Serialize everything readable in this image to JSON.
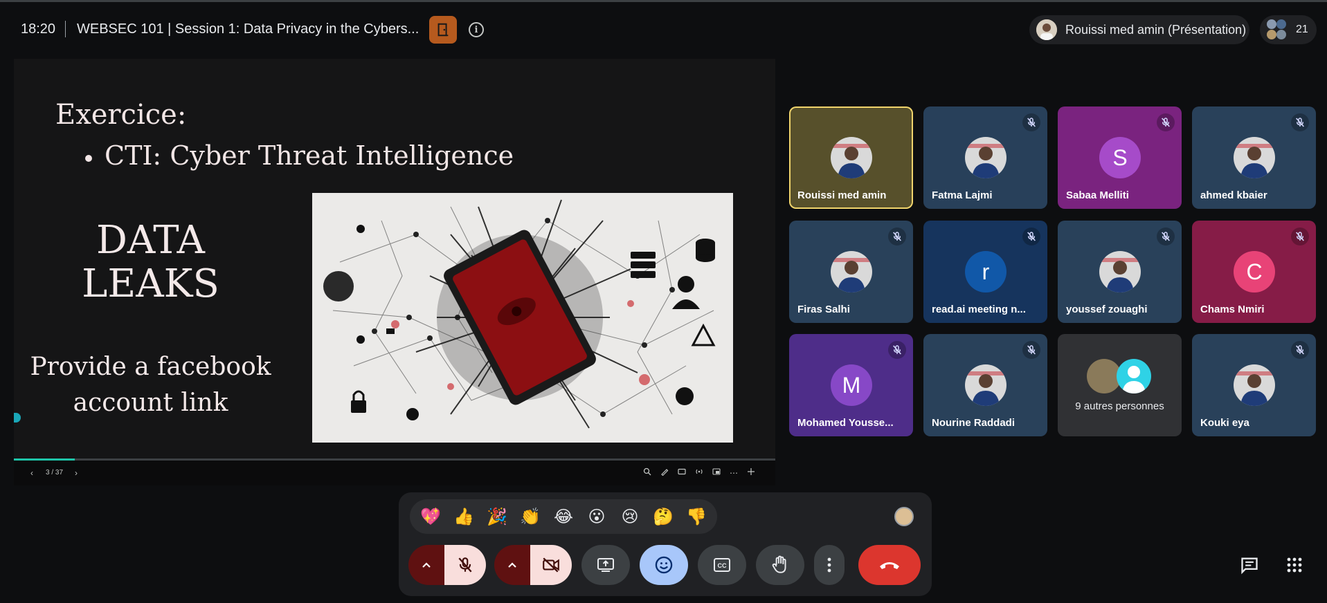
{
  "topbar": {
    "time": "18:20",
    "meeting_title": "WEBSEC 101 | Session 1: Data Privacy in the Cybers...",
    "presenter_chip_label": "Rouissi med amin (Présentation)",
    "participant_count": "21"
  },
  "slide": {
    "heading": "Exercice:",
    "bullet": "CTI: Cyber Threat Intelligence",
    "big_line_1": "DATA",
    "big_line_2": "LEAKS",
    "sub_line_1": "Provide a facebook",
    "sub_line_2": "account link",
    "progress_fraction": 0.08
  },
  "slide_controls": {
    "page_indicator": "3 / 37"
  },
  "tiles": [
    {
      "name": "Rouissi med amin",
      "kind": "photo",
      "active": true,
      "muted": false,
      "bg": "#57502b"
    },
    {
      "name": "Fatma Lajmi",
      "kind": "photo",
      "active": false,
      "muted": true,
      "bg": "#28405a"
    },
    {
      "name": "Sabaa Melliti",
      "kind": "letter",
      "letter": "S",
      "letter_bg": "#a64bc9",
      "active": false,
      "muted": true,
      "bg": "#7a237f"
    },
    {
      "name": "ahmed kbaier",
      "kind": "photo",
      "active": false,
      "muted": true,
      "bg": "#29415a"
    },
    {
      "name": "Firas Salhi",
      "kind": "photo",
      "active": false,
      "muted": true,
      "bg": "#29415a"
    },
    {
      "name": "read.ai meeting n...",
      "kind": "letter",
      "letter": "r",
      "letter_bg": "#1158a8",
      "active": false,
      "muted": true,
      "bg": "#16345d"
    },
    {
      "name": "youssef zouaghi",
      "kind": "photo",
      "active": false,
      "muted": true,
      "bg": "#29415a"
    },
    {
      "name": "Chams Nmiri",
      "kind": "letter",
      "letter": "C",
      "letter_bg": "#e84377",
      "active": false,
      "muted": true,
      "bg": "#861c47"
    },
    {
      "name": "Mohamed Yousse...",
      "kind": "letter",
      "letter": "M",
      "letter_bg": "#8748c7",
      "active": false,
      "muted": true,
      "bg": "#4e2d89"
    },
    {
      "name": "Nourine Raddadi",
      "kind": "photo",
      "active": false,
      "muted": true,
      "bg": "#29415a"
    },
    {
      "name": "9 autres personnes",
      "kind": "overflow",
      "active": false,
      "muted": false,
      "bg": "#303134"
    },
    {
      "name": "Kouki eya",
      "kind": "photo",
      "active": false,
      "muted": true,
      "bg": "#29415a"
    }
  ],
  "reactions": [
    {
      "icon": "sparkling-heart",
      "glyph": "💖"
    },
    {
      "icon": "thumbs-up",
      "glyph": "👍"
    },
    {
      "icon": "party-popper",
      "glyph": "🎉"
    },
    {
      "icon": "clapping-hands",
      "glyph": "👏"
    },
    {
      "icon": "tears-of-joy",
      "glyph": "😂"
    },
    {
      "icon": "surprised-face",
      "glyph": "😮"
    },
    {
      "icon": "crying-face",
      "glyph": "😢"
    },
    {
      "icon": "thinking-face",
      "glyph": "🤔"
    },
    {
      "icon": "thumbs-down",
      "glyph": "👎"
    }
  ],
  "colors": {
    "active_speaker_border": "#f1d56c",
    "leave_red": "#dc362e",
    "reactions_on_blue": "#a8c7fa",
    "progress_teal": "#1ec4a8"
  }
}
